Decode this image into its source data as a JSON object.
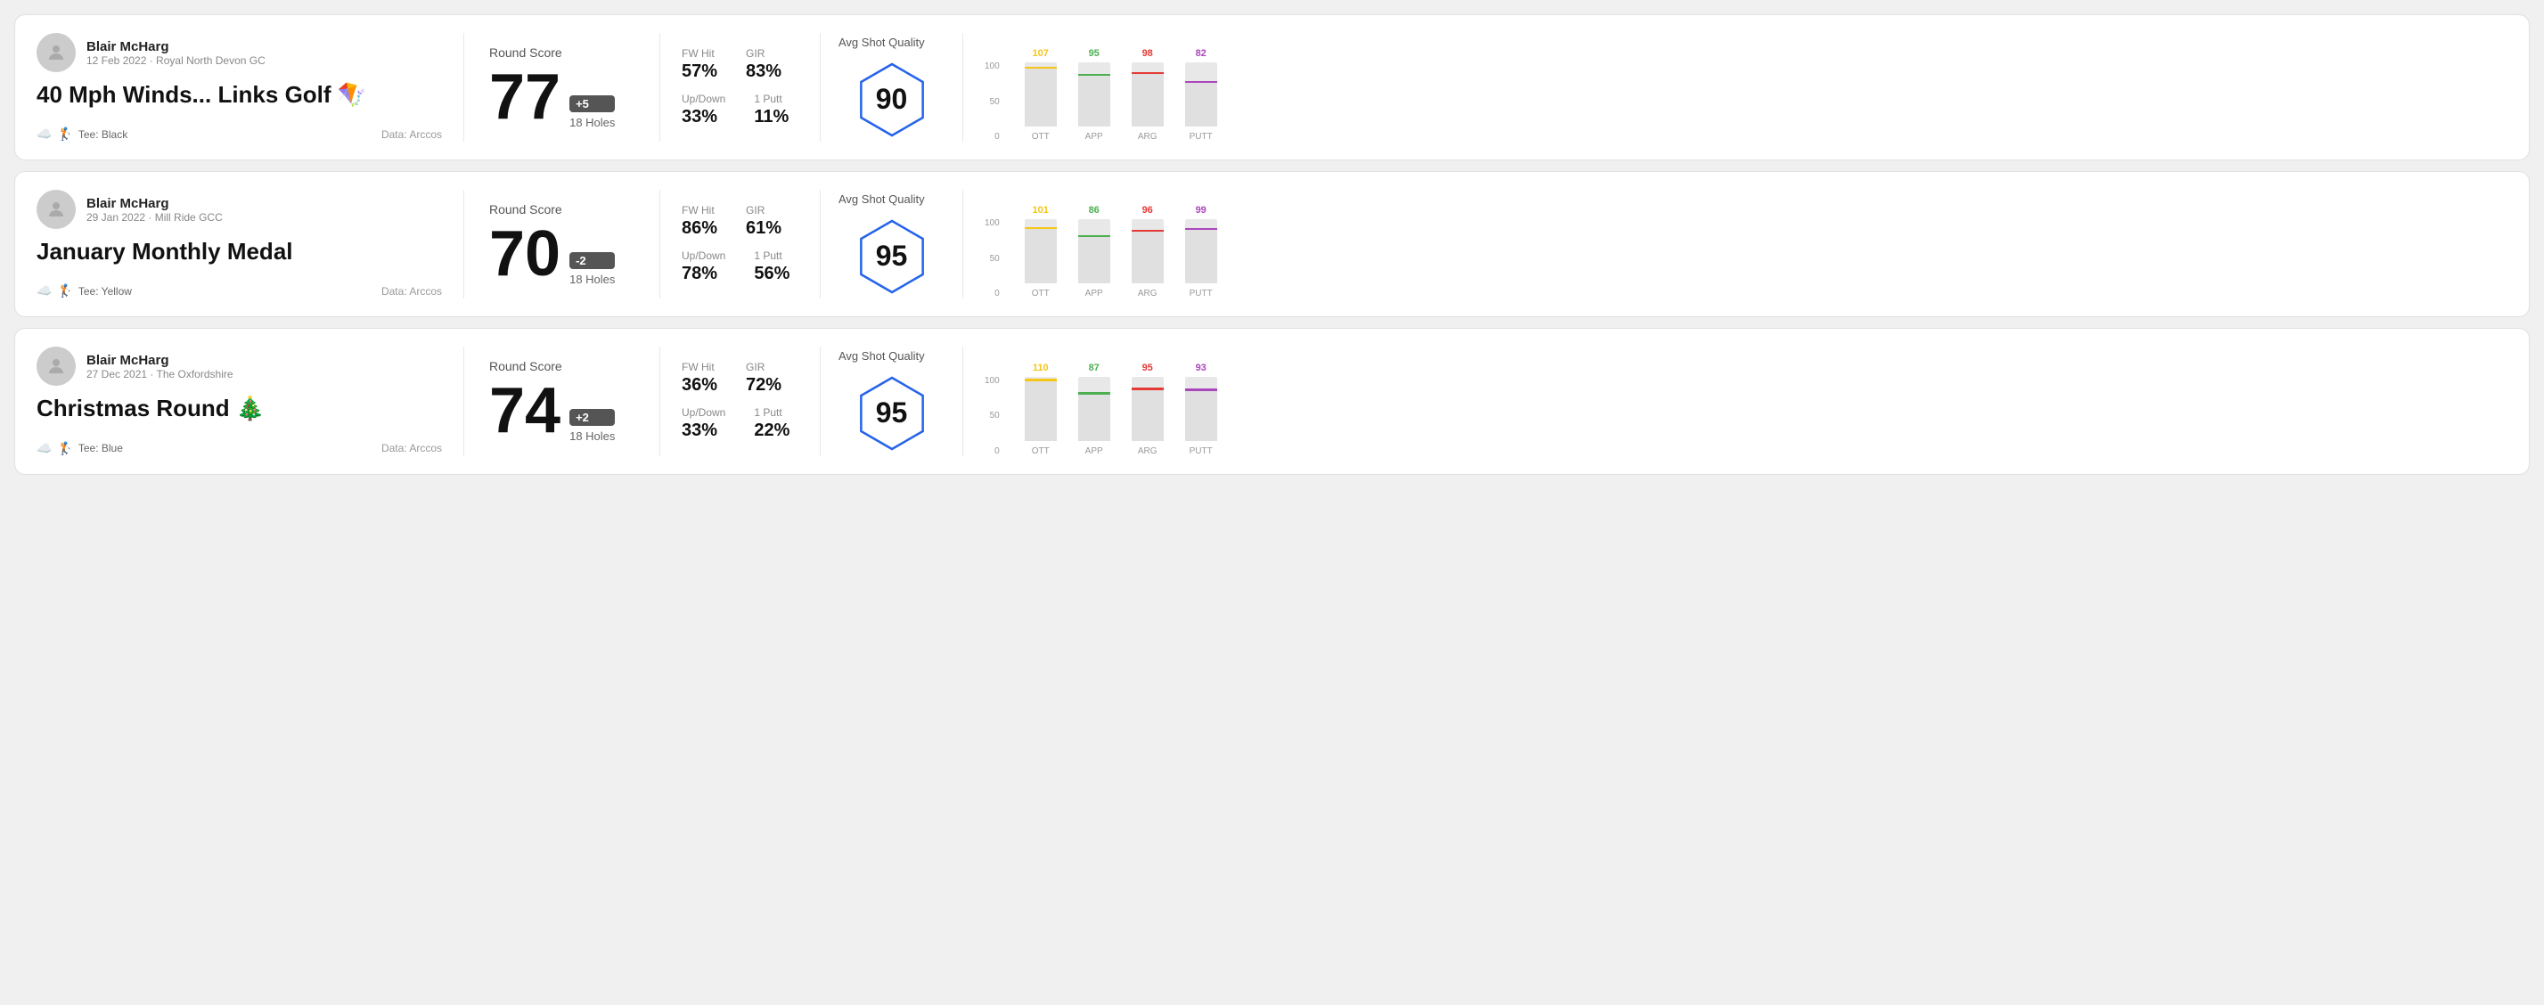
{
  "rounds": [
    {
      "id": "round1",
      "user": {
        "name": "Blair McHarg",
        "date": "12 Feb 2022",
        "course": "Royal North Devon GC"
      },
      "title": "40 Mph Winds... Links Golf 🪁",
      "tee": "Black",
      "data_source": "Data: Arccos",
      "score": "77",
      "score_diff": "+5",
      "holes": "18 Holes",
      "fw_hit": "57%",
      "gir": "83%",
      "up_down": "33%",
      "one_putt": "11%",
      "quality_score": "90",
      "quality_label": "Avg Shot Quality",
      "chart_bars": [
        {
          "label": "OTT",
          "value": 107,
          "color": "#f5c518"
        },
        {
          "label": "APP",
          "value": 95,
          "color": "#4caf50"
        },
        {
          "label": "ARG",
          "value": 98,
          "color": "#e53935"
        },
        {
          "label": "PUTT",
          "value": 82,
          "color": "#ab47bc"
        }
      ]
    },
    {
      "id": "round2",
      "user": {
        "name": "Blair McHarg",
        "date": "29 Jan 2022",
        "course": "Mill Ride GCC"
      },
      "title": "January Monthly Medal",
      "tee": "Yellow",
      "data_source": "Data: Arccos",
      "score": "70",
      "score_diff": "-2",
      "holes": "18 Holes",
      "fw_hit": "86%",
      "gir": "61%",
      "up_down": "78%",
      "one_putt": "56%",
      "quality_score": "95",
      "quality_label": "Avg Shot Quality",
      "chart_bars": [
        {
          "label": "OTT",
          "value": 101,
          "color": "#f5c518"
        },
        {
          "label": "APP",
          "value": 86,
          "color": "#4caf50"
        },
        {
          "label": "ARG",
          "value": 96,
          "color": "#e53935"
        },
        {
          "label": "PUTT",
          "value": 99,
          "color": "#ab47bc"
        }
      ]
    },
    {
      "id": "round3",
      "user": {
        "name": "Blair McHarg",
        "date": "27 Dec 2021",
        "course": "The Oxfordshire"
      },
      "title": "Christmas Round 🎄",
      "tee": "Blue",
      "data_source": "Data: Arccos",
      "score": "74",
      "score_diff": "+2",
      "holes": "18 Holes",
      "fw_hit": "36%",
      "gir": "72%",
      "up_down": "33%",
      "one_putt": "22%",
      "quality_score": "95",
      "quality_label": "Avg Shot Quality",
      "chart_bars": [
        {
          "label": "OTT",
          "value": 110,
          "color": "#f5c518"
        },
        {
          "label": "APP",
          "value": 87,
          "color": "#4caf50"
        },
        {
          "label": "ARG",
          "value": 95,
          "color": "#e53935"
        },
        {
          "label": "PUTT",
          "value": 93,
          "color": "#ab47bc"
        }
      ]
    }
  ],
  "chart_y_labels": [
    "100",
    "50",
    "0"
  ]
}
